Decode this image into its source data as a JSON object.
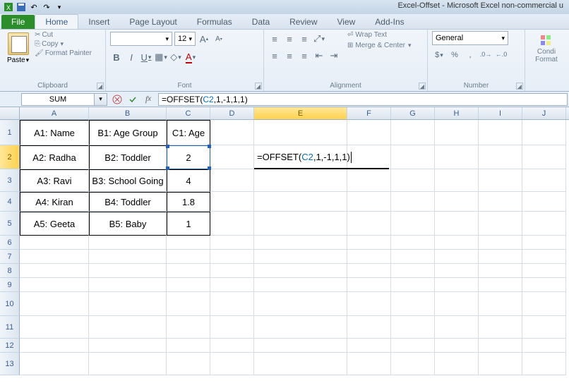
{
  "titlebar": {
    "title": "Excel-Offset - Microsoft Excel non-commercial u"
  },
  "tabs": {
    "file": "File",
    "home": "Home",
    "insert": "Insert",
    "pagelayout": "Page Layout",
    "formulas": "Formulas",
    "data": "Data",
    "review": "Review",
    "view": "View",
    "addins": "Add-Ins"
  },
  "ribbon": {
    "clipboard": {
      "label": "Clipboard",
      "paste": "Paste",
      "cut": "Cut",
      "copy": "Copy",
      "format_painter": "Format Painter"
    },
    "font": {
      "label": "Font",
      "name": "",
      "size": "12"
    },
    "alignment": {
      "label": "Alignment",
      "wrap": "Wrap Text",
      "merge": "Merge & Center"
    },
    "number": {
      "label": "Number",
      "format": "General"
    },
    "conditional": {
      "label1": "Condi",
      "label2": "Format"
    }
  },
  "formula_bar": {
    "name_box": "SUM",
    "formula_prefix": "=OFFSET(",
    "formula_ref": "C2",
    "formula_suffix": ",1,-1,1,1)"
  },
  "sheet": {
    "columns": [
      "A",
      "B",
      "C",
      "D",
      "E",
      "F",
      "G",
      "H",
      "I",
      "J"
    ],
    "data": {
      "r1": {
        "A": "A1: Name",
        "B": "B1: Age Group",
        "C": "C1: Age"
      },
      "r2": {
        "A": "A2: Radha",
        "B": "B2: Toddler",
        "C": "2"
      },
      "r3": {
        "A": "A3: Ravi",
        "B": "B3: School Going",
        "C": "4"
      },
      "r4": {
        "A": "A4: Kiran",
        "B": "B4: Toddler",
        "C": "1.8"
      },
      "r5": {
        "A": "A5: Geeta",
        "B": "B5: Baby",
        "C": "1"
      }
    },
    "editing": {
      "prefix": "=OFFSET(",
      "ref": "C2",
      "suffix": ",1,-1,1,1)"
    }
  }
}
